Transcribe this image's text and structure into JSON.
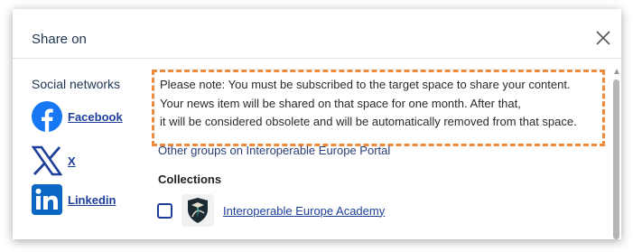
{
  "dialog": {
    "title": "Share on",
    "close_icon": "close-icon"
  },
  "sidebar": {
    "title": "Social networks",
    "items": [
      {
        "label": "Facebook",
        "icon": "facebook-icon",
        "color": "#1877f2"
      },
      {
        "label": "X",
        "icon": "x-icon",
        "color": "#1d3f9a"
      },
      {
        "label": "Linkedin",
        "icon": "linkedin-icon",
        "color": "#0a66c2"
      }
    ]
  },
  "notice": {
    "lines": [
      "Please note: You must be subscribed to the target space to share your content.",
      "Your news item will be shared on that space for one month. After that,",
      "it will be considered obsolete and will be automatically removed from that space."
    ],
    "border_color": "#ee8a3c"
  },
  "main": {
    "other_groups_label": "Other groups on Interoperable Europe Portal",
    "collections_heading": "Collections",
    "collections": [
      {
        "label": "Interoperable Europe Academy",
        "checked": false,
        "icon": "academy-shield-icon"
      }
    ]
  }
}
